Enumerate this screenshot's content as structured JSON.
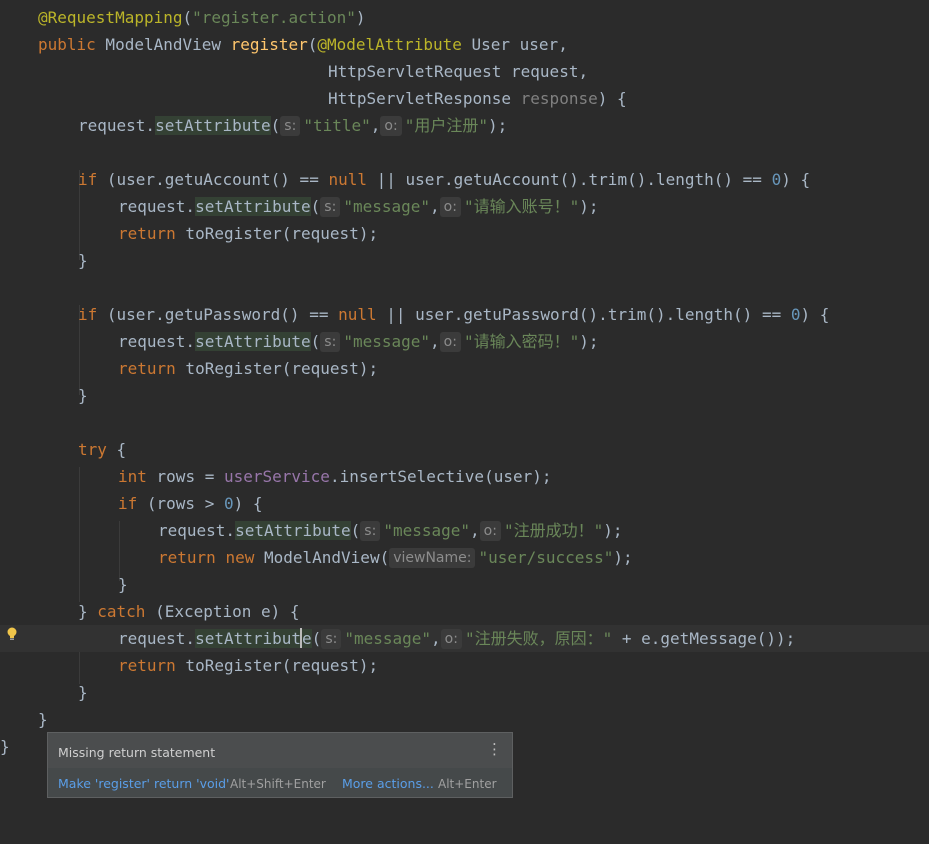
{
  "code": {
    "l1": {
      "ann": "@RequestMapping",
      "p": "(",
      "s": "\"register.action\"",
      "e": ")"
    },
    "l2": {
      "kw": "public",
      "t1": " ModelAndView ",
      "fn": "register",
      "t2": "(",
      "ann": "@ModelAttribute",
      "t3": " User user,"
    },
    "l3": {
      "t": "HttpServletRequest request,"
    },
    "l4": {
      "t": "HttpServletResponse ",
      "unused": "response",
      "e": ") {"
    },
    "l5": {
      "t": "request.",
      "m": "setAttribute",
      "p": "(",
      "h1": "s:",
      "s1": "\"title\"",
      "c": ",",
      "h2": "o:",
      "s2": "\"用户注册\"",
      "e": ");"
    },
    "l7": {
      "kw": "if",
      "t1": " (user.getuAccount() == ",
      "kw2": "null",
      "t2": " || user.getuAccount().trim().length() == ",
      "num": "0",
      "e": ") {"
    },
    "l8": {
      "t": "request.",
      "m": "setAttribute",
      "p": "(",
      "h1": "s:",
      "s1": "\"message\"",
      "c": ",",
      "h2": "o:",
      "s2": "\"请输入账号！\"",
      "e": ");"
    },
    "l9": {
      "kw": "return",
      "t": " toRegister(request);"
    },
    "l10": {
      "t": "}"
    },
    "l12": {
      "kw": "if",
      "t1": " (user.getuPassword() == ",
      "kw2": "null",
      "t2": " || user.getuPassword().trim().length() == ",
      "num": "0",
      "e": ") {"
    },
    "l13": {
      "t": "request.",
      "m": "setAttribute",
      "p": "(",
      "h1": "s:",
      "s1": "\"message\"",
      "c": ",",
      "h2": "o:",
      "s2": "\"请输入密码！\"",
      "e": ");"
    },
    "l14": {
      "kw": "return",
      "t": " toRegister(request);"
    },
    "l15": {
      "t": "}"
    },
    "l17": {
      "kw": "try",
      "t": " {"
    },
    "l18": {
      "kw": "int",
      "t1": " rows = ",
      "field": "userService",
      "t2": ".insertSelective(user);"
    },
    "l19": {
      "kw": "if",
      "t1": " (rows > ",
      "num": "0",
      "e": ") {"
    },
    "l20": {
      "t": "request.",
      "m": "setAttribute",
      "p": "(",
      "h1": "s:",
      "s1": "\"message\"",
      "c": ",",
      "h2": "o:",
      "s2": "\"注册成功！\"",
      "e": ");"
    },
    "l21": {
      "kw": "return",
      "kw2": "new",
      "t": " ModelAndView(",
      "h": "viewName:",
      "s": "\"user/success\"",
      "e": ");"
    },
    "l22": {
      "t": "}"
    },
    "l23": {
      "t1": "} ",
      "kw": "catch",
      "t2": " (Exception e) {"
    },
    "l24": {
      "t": "request.",
      "m1": "setAttribut",
      "m2": "e",
      "p": "(",
      "h1": "s:",
      "s1": "\"message\"",
      "c": ",",
      "h2": "o:",
      "s2": "\"注册失败，原因：\"",
      "e": " + e.getMessage());"
    },
    "l25": {
      "kw": "return",
      "t": " toRegister(request);"
    },
    "l26": {
      "t": "}"
    },
    "l27": {
      "t": "}"
    },
    "l28": {
      "t": "}"
    }
  },
  "popup": {
    "message": "Missing return statement",
    "more_icon": "⋮",
    "action1": "Make 'register' return 'void'",
    "shortcut1": "Alt+Shift+Enter",
    "action2": "More actions...",
    "shortcut2": "Alt+Enter"
  },
  "icons": {
    "intention": "lightbulb-icon"
  },
  "colors": {
    "background": "#2b2b2b",
    "keyword": "#cc7832",
    "string": "#6a8759",
    "annotation": "#bbb529",
    "number": "#6897bb",
    "link": "#5a9ee8"
  }
}
